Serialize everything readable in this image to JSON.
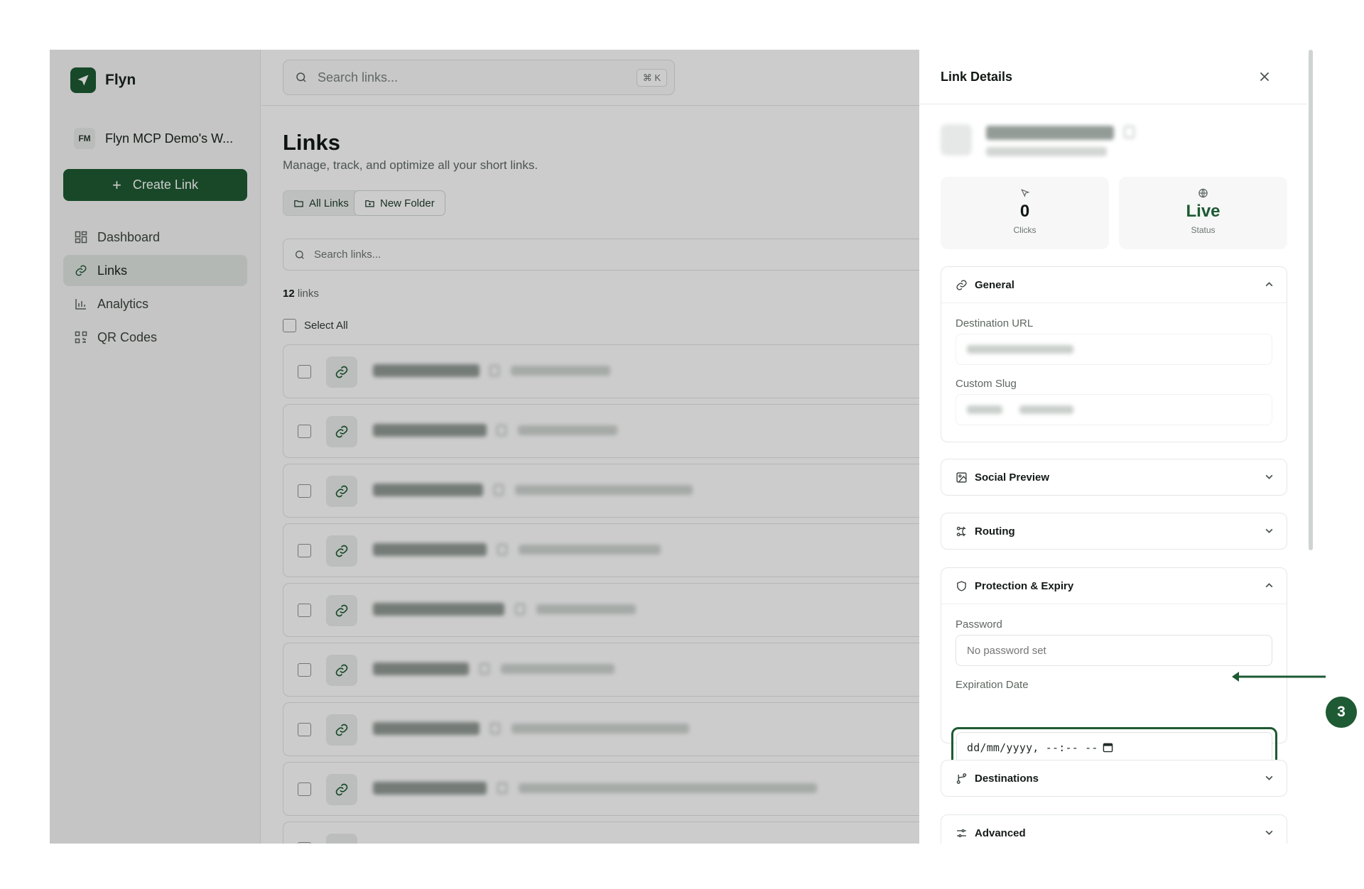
{
  "app": {
    "name": "Flyn"
  },
  "workspace": {
    "initials": "FM",
    "name": "Flyn MCP Demo's W..."
  },
  "sidebar": {
    "create_label": "Create Link",
    "items": [
      {
        "label": "Dashboard",
        "icon": "dashboard-icon",
        "active": false
      },
      {
        "label": "Links",
        "icon": "link-icon",
        "active": true
      },
      {
        "label": "Analytics",
        "icon": "bar-chart-icon",
        "active": false
      },
      {
        "label": "QR Codes",
        "icon": "qr-code-icon",
        "active": false
      }
    ]
  },
  "topbar": {
    "search_placeholder": "Search links...",
    "shortcut": "⌘ K"
  },
  "page": {
    "title": "Links",
    "subtitle": "Manage, track, and optimize all your short links.",
    "all_links_label": "All Links",
    "new_folder_label": "New Folder",
    "search_placeholder": "Search links...",
    "count_number": "12",
    "count_label": " links",
    "select_all_label": "Select All"
  },
  "panel": {
    "title": "Link Details",
    "stats": [
      {
        "value": "0",
        "label": "Clicks",
        "icon": "cursor-icon"
      },
      {
        "value": "Live",
        "label": "Status",
        "icon": "globe-icon"
      }
    ],
    "sections": {
      "general": {
        "title": "General",
        "destination_label": "Destination URL",
        "slug_label": "Custom Slug"
      },
      "social": {
        "title": "Social Preview"
      },
      "routing": {
        "title": "Routing"
      },
      "protection": {
        "title": "Protection & Expiry",
        "password_label": "Password",
        "password_placeholder": "No password set",
        "expiration_label": "Expiration Date",
        "expiration_value": "dd/mm/yyyy, --:-- --"
      },
      "destinations": {
        "title": "Destinations"
      },
      "advanced": {
        "title": "Advanced"
      }
    }
  },
  "callout": {
    "number": "3"
  },
  "colors": {
    "brand": "#1e5a33",
    "accent_text": "#1e5a33"
  }
}
